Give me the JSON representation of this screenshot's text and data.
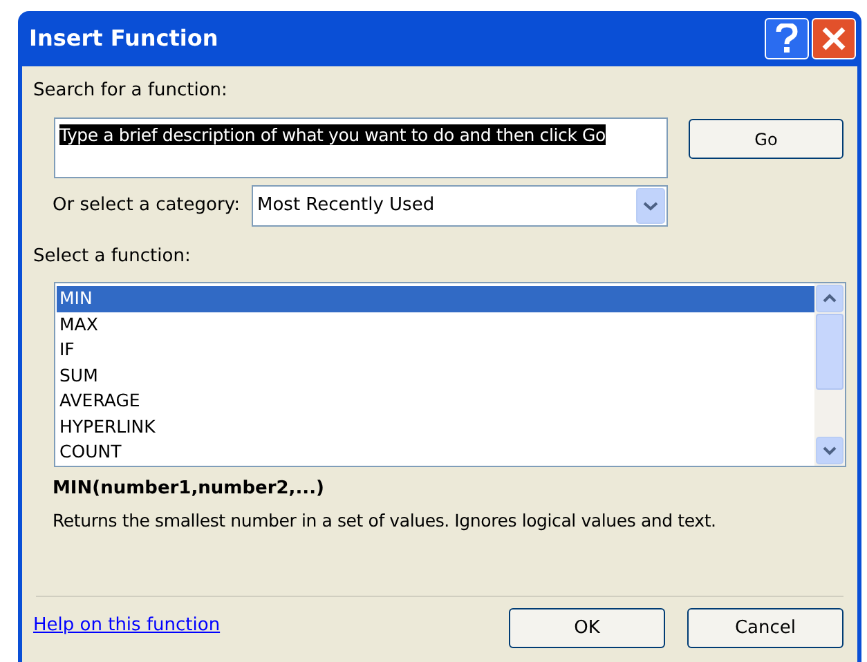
{
  "window": {
    "title": "Insert Function"
  },
  "search": {
    "label": "Search for a function:",
    "value": "Type a brief description of what you want to do and then click Go",
    "value_selected": true,
    "go_button": "Go"
  },
  "category": {
    "label": "Or select a category:",
    "value": "Most Recently Used"
  },
  "functions": {
    "label": "Select a function:",
    "items": [
      {
        "name": "MIN",
        "selected": true
      },
      {
        "name": "MAX",
        "selected": false
      },
      {
        "name": "IF",
        "selected": false
      },
      {
        "name": "SUM",
        "selected": false
      },
      {
        "name": "AVERAGE",
        "selected": false
      },
      {
        "name": "HYPERLINK",
        "selected": false
      },
      {
        "name": "COUNT",
        "selected": false
      }
    ]
  },
  "signature": "MIN(number1,number2,...)",
  "description": "Returns the smallest number in a set of values. Ignores logical values and text.",
  "help_link": "Help on this function",
  "buttons": [
    {
      "label": "OK"
    },
    {
      "label": "Cancel"
    }
  ]
}
